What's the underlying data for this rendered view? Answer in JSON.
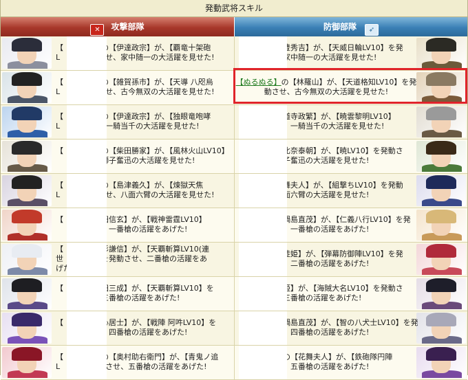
{
  "title": "発動武将スキル",
  "attack_header": "攻撃部隊",
  "defense_header": "防御部隊",
  "attack_icon": "sword-cross-icon",
  "defense_icon": "shield-icon",
  "rows": [
    {
      "attack": {
        "line1": "【　　　　】の【伊達政宗】が、【覇竜十架砲",
        "line2": "L　　　　　させ、家中随一の大活躍を見せた!"
      },
      "defense": {
        "line1": "豊秀吉】が、【天威日輪LV10】を発",
        "line2": "家中随一の大活躍を見せた!"
      }
    },
    {
      "attack": {
        "line1": "【　　　　】の【雑賀孫市】が、【天導 八咫烏",
        "line2": "L　　　　　させ、古今無双の大活躍を見せた!"
      },
      "defense": {
        "link": "ぬるぬる",
        "line1a": "の【林羅山】が、【天道格知LV10】を発",
        "line2": "動させ、古今無双の大活躍を見せた!"
      }
    },
    {
      "attack": {
        "line1": "【　　　　】の【伊達政宗】が、【独眼竜咆哮",
        "line2": "L　　　　　、一騎当千の大活躍を見せた!"
      },
      "defense": {
        "line1": "道寺政繁】が、【暁雲黎明LV10】",
        "line2": "、一騎当千の大活躍を見せた!"
      }
    },
    {
      "attack": {
        "line1": "【　　　　】の【柴田勝家】が、【風林火山LV10】",
        "line2": "　　　　　、獅子奮迅の大活躍を見せた!"
      },
      "defense": {
        "line1": "比奈泰朝】が、【暁LV10】を発動さ",
        "line2": "子奮迅の大活躍を見せた!"
      }
    },
    {
      "attack": {
        "line1": "【　　　　】の【島津義久】が、【煉獄天焦",
        "line2": "L　　　　　させ、八面六臂の大活躍を見せた!"
      },
      "defense": {
        "line1": "舞夫人】が、【組撃ちLV10】を発動",
        "line2": "面六臂の大活躍を見せた!"
      }
    },
    {
      "attack": {
        "line1": "【　　　　武田信玄】が、【戦神雷霆LV10】",
        "line2": "　　　　　せ、一番槍の活躍をあげた!"
      },
      "defense": {
        "line1": "鍋島直茂】が、【仁義八行LV10】を発",
        "line2": "、一番槍の活躍をあげた!"
      }
    },
    {
      "attack": {
        "line1": "【　　　　上杉謙信】が、【天覇斬算LV10(連",
        "line2": "世　　　　】を発動させ、二番槍の活躍をあ",
        "line3": "げた!"
      },
      "defense": {
        "line1": "徒姫】が、【弾幕防御陣LV10】を発",
        "line2": "、二番槍の活躍をあげた!"
      }
    },
    {
      "attack": {
        "line1": "【　　　　石田三成】が、【天覇斬算LV10】を",
        "line2": "　　　　　、三番槍の活躍をあげた!"
      },
      "defense": {
        "line1": "姫】が、【海賊大名LV10】を発動さ",
        "line2": "三番槍の活躍をあげた!"
      }
    },
    {
      "attack": {
        "line1": "【　　　　鳥心居士】が、【戦陣 阿吽LV10】を",
        "line2": "　　　　　せ、四番槍の活躍をあげた!"
      },
      "defense": {
        "line1": "鍋島直茂】が、【智の八犬士LV10】を発",
        "line2": "、四番槍の活躍をあげた!"
      }
    },
    {
      "attack": {
        "line1": "【　　　　】の【奥村助右衛門】が、【青鬼ノ追",
        "line2": "L　　　　　動させ、五番槍の活躍をあげた!"
      },
      "defense": {
        "line1": "の【花舞夫人】が、【鉄砲隊円陣",
        "line2": "、五番槍の活躍をあげた!"
      }
    }
  ],
  "colors": {
    "attack_header": "#a7372a",
    "defense_header": "#3a7fb5",
    "highlight_border": "#e0242a",
    "link": "#1f7a1f"
  },
  "portraits_left": [
    "masked-helmet-warrior",
    "dark-hair-gunner",
    "blue-armor-dragon",
    "bearded-general",
    "dark-armor-lord",
    "red-lion-helm",
    "white-hood-monk",
    "dark-hair-strategist",
    "purple-hat-sage",
    "red-oni-warrior"
  ],
  "portraits_right": [
    "topknot-lord",
    "old-scholar",
    "grey-hair-elder",
    "green-armor-youth",
    "blue-hair-lady",
    "blonde-lady",
    "red-hair-lady",
    "dark-hair-princess",
    "silver-hair-youth",
    "purple-hair-lady"
  ]
}
